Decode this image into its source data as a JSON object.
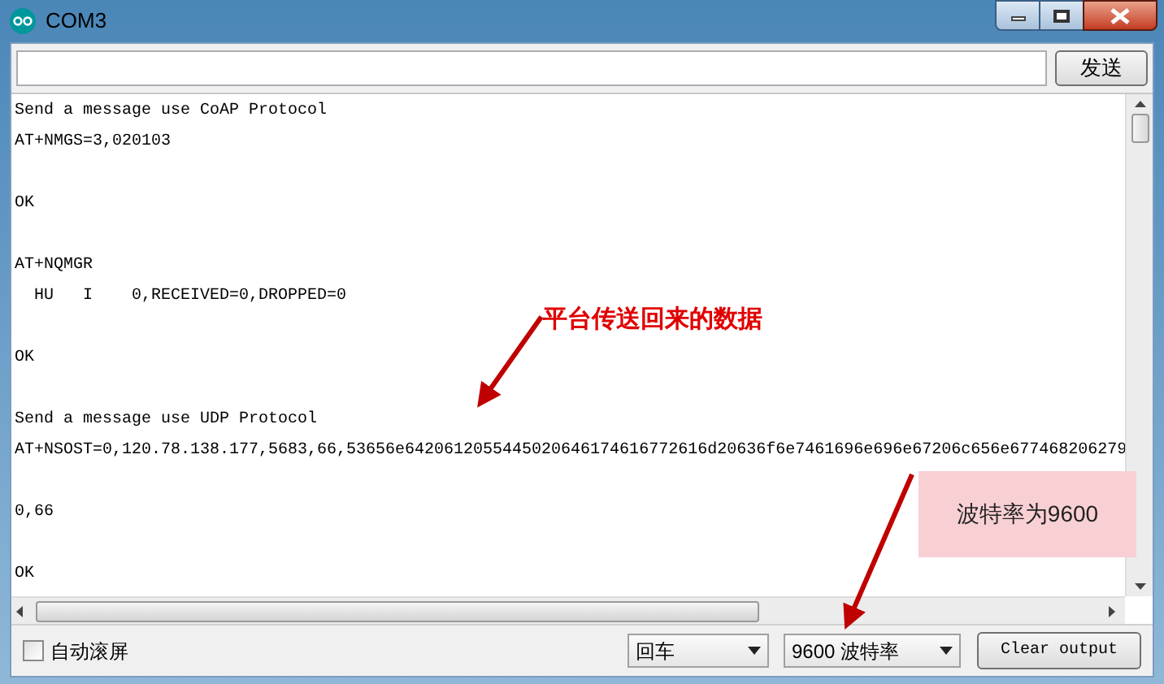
{
  "window": {
    "title": "COM3"
  },
  "send_bar": {
    "send_button": "发送"
  },
  "output": {
    "lines": [
      {
        "kind": "text",
        "text": "Send a message use CoAP Protocol"
      },
      {
        "kind": "text",
        "text": "AT+NMGS=3,020103"
      },
      {
        "kind": "blank"
      },
      {
        "kind": "text",
        "text": "OK"
      },
      {
        "kind": "blank"
      },
      {
        "kind": "text",
        "text": "AT+NQMGR"
      },
      {
        "kind": "text",
        "text": "  HU   I    0,RECEIVED=0,DROPPED=0"
      },
      {
        "kind": "blank"
      },
      {
        "kind": "text",
        "text": "OK"
      },
      {
        "kind": "blank"
      },
      {
        "kind": "text",
        "text": "Send a message use UDP Protocol"
      },
      {
        "kind": "text",
        "text": "AT+NSOST=0,120.78.138.177,5683,66,53656e6420612055445020646174616772616d20636f6e7461696e696e67206c656e677468206279"
      },
      {
        "kind": "blank"
      },
      {
        "kind": "text",
        "text": "0,66"
      },
      {
        "kind": "blank"
      },
      {
        "kind": "text",
        "text": "OK"
      }
    ]
  },
  "bottom_bar": {
    "autoscroll": {
      "label": "自动滚屏",
      "checked": false
    },
    "line_ending": "回车",
    "baud_rate": "9600 波特率",
    "clear_button": "Clear output"
  },
  "annotations": [
    {
      "kind": "arrow_label",
      "text": "平台传送回来的数据"
    },
    {
      "kind": "callout_box",
      "text": "波特率为9600"
    }
  ]
}
